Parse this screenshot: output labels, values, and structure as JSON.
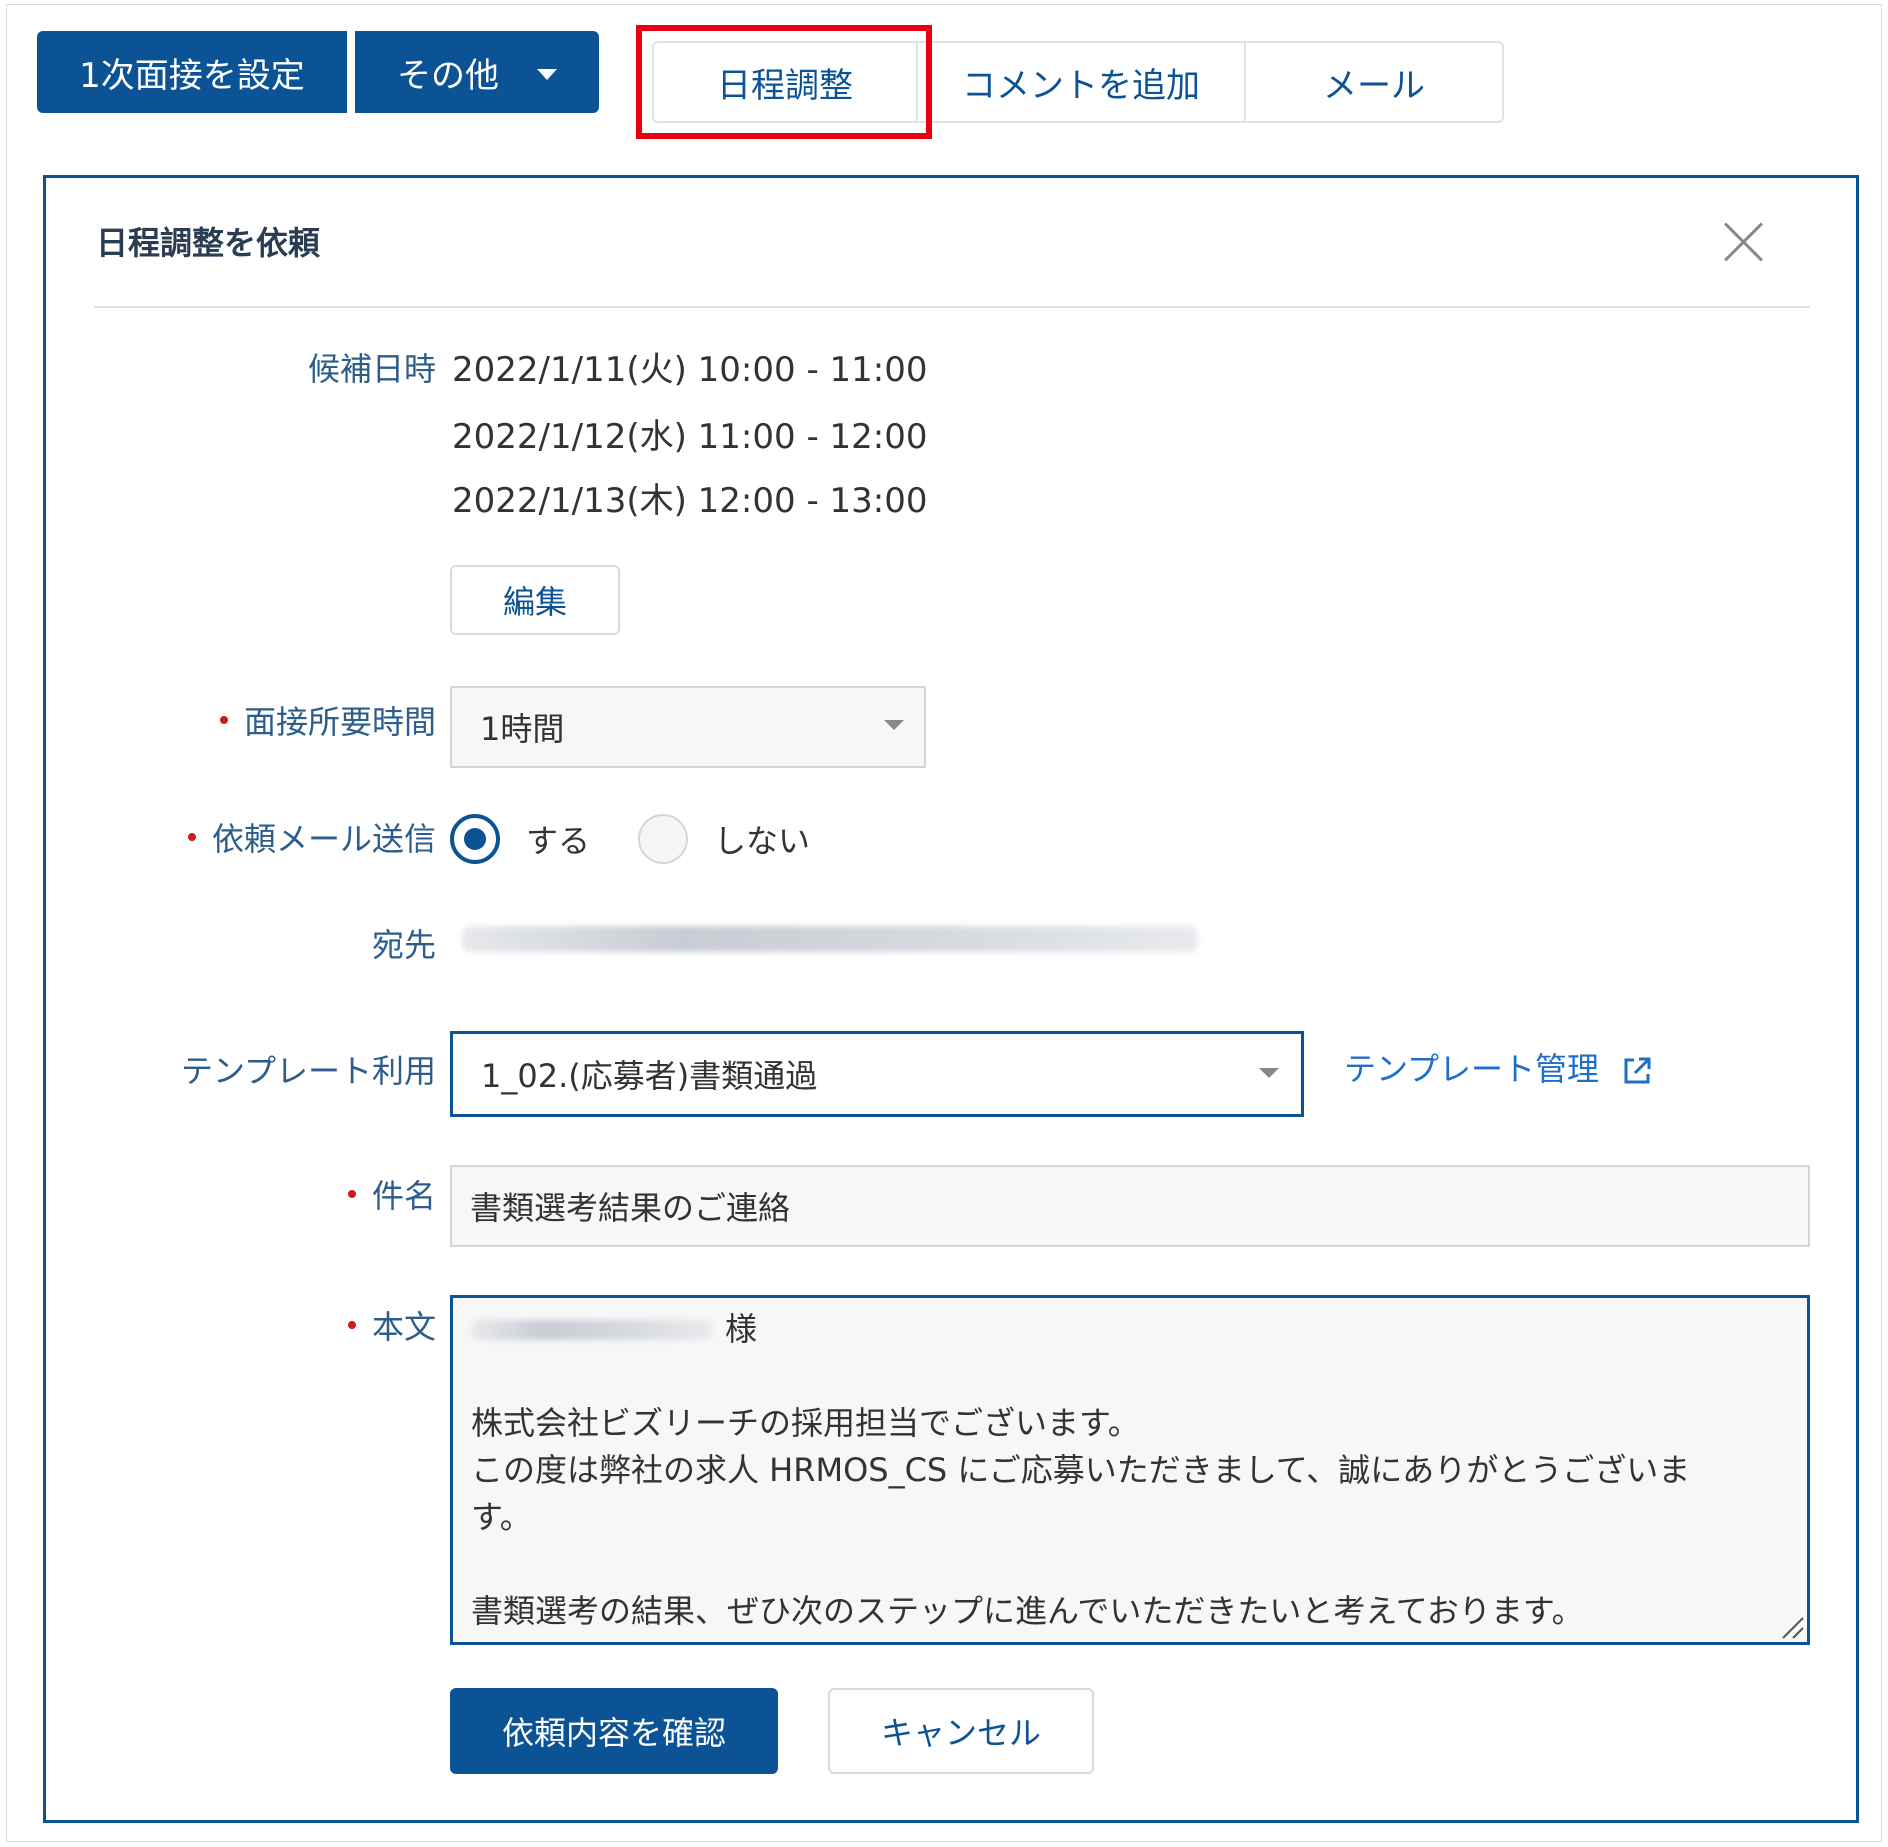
{
  "toolbar": {
    "set_interview_label": "1次面接を設定",
    "other_label": "その他",
    "tabs": [
      {
        "label": "日程調整"
      },
      {
        "label": "コメントを追加"
      },
      {
        "label": "メール"
      }
    ]
  },
  "dialog": {
    "title": "日程調整を依頼",
    "candidate_label": "候補日時",
    "candidate_dates": [
      "2022/1/11(火) 10:00 - 11:00",
      "2022/1/12(水) 11:00 - 12:00",
      "2022/1/13(木) 12:00 - 13:00"
    ],
    "edit_label": "編集",
    "duration_label": "面接所要時間",
    "duration_value": "1時間",
    "send_mail_label": "依頼メール送信",
    "send_options": [
      {
        "label": "する",
        "checked": true
      },
      {
        "label": "しない",
        "checked": false
      }
    ],
    "recipient_label": "宛先",
    "template_label": "テンプレート利用",
    "template_value": "1_02.(応募者)書類通過",
    "template_manage_label": "テンプレート管理",
    "subject_label": "件名",
    "subject_value": "書類選考結果のご連絡",
    "body_label": "本文",
    "body_salutation": "様",
    "body_lines": [
      "",
      "株式会社ビズリーチの採用担当でございます。",
      "この度は弊社の求人 HRMOS_CS にご応募いただきまして、誠にありがとうございま",
      "す。",
      "",
      "書類選考の結果、ぜひ次のステップに進んでいただきたいと考えております。"
    ],
    "confirm_label": "依頼内容を確認",
    "cancel_label": "キャンセル"
  },
  "colors": {
    "primary": "#0b5394",
    "highlight": "#e60012",
    "required": "#cc1b1b",
    "link": "#1d6fc9"
  },
  "icons": [
    "chevron-down-icon",
    "close-icon",
    "external-link-icon",
    "resize-grip-icon"
  ]
}
